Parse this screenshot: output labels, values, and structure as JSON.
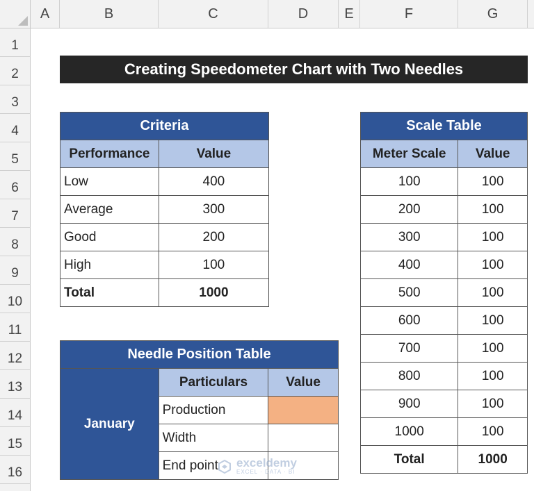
{
  "columns": [
    "A",
    "B",
    "C",
    "D",
    "E",
    "F",
    "G"
  ],
  "rows": [
    "1",
    "2",
    "3",
    "4",
    "5",
    "6",
    "7",
    "8",
    "9",
    "10",
    "11",
    "12",
    "13",
    "14",
    "15",
    "16"
  ],
  "title": "Creating Speedometer Chart with Two Needles",
  "criteria": {
    "header": "Criteria",
    "col_performance": "Performance",
    "col_value": "Value",
    "rows": [
      {
        "performance": "Low",
        "value": "400"
      },
      {
        "performance": "Average",
        "value": "300"
      },
      {
        "performance": "Good",
        "value": "200"
      },
      {
        "performance": "High",
        "value": "100"
      }
    ],
    "total_label": "Total",
    "total_value": "1000"
  },
  "needle": {
    "header": "Needle Position Table",
    "group_label": "January",
    "col_particulars": "Particulars",
    "col_value": "Value",
    "rows": [
      {
        "particular": "Production",
        "value": ""
      },
      {
        "particular": "Width",
        "value": ""
      },
      {
        "particular": "End point",
        "value": ""
      }
    ],
    "highlight_color": "#f4b183"
  },
  "scale": {
    "header": "Scale Table",
    "col_meter": "Meter Scale",
    "col_value": "Value",
    "rows": [
      {
        "meter": "100",
        "value": "100"
      },
      {
        "meter": "200",
        "value": "100"
      },
      {
        "meter": "300",
        "value": "100"
      },
      {
        "meter": "400",
        "value": "100"
      },
      {
        "meter": "500",
        "value": "100"
      },
      {
        "meter": "600",
        "value": "100"
      },
      {
        "meter": "700",
        "value": "100"
      },
      {
        "meter": "800",
        "value": "100"
      },
      {
        "meter": "900",
        "value": "100"
      },
      {
        "meter": "1000",
        "value": "100"
      }
    ],
    "total_label": "Total",
    "total_value": "1000"
  },
  "watermark": {
    "brand": "exceldemy",
    "tagline": "EXCEL · DATA · BI"
  },
  "colors": {
    "header_dark": "#2f5597",
    "header_light": "#b4c7e7",
    "title_bg": "#262626"
  }
}
